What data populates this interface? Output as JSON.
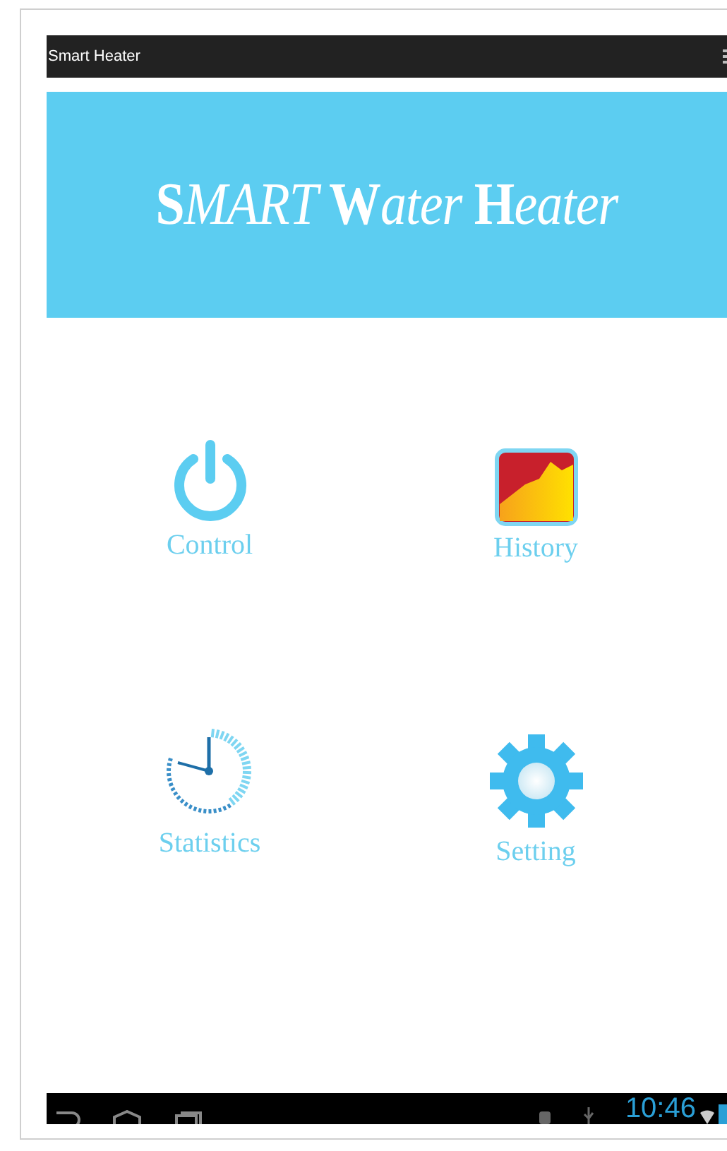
{
  "action_bar": {
    "title": "Smart Heater"
  },
  "banner": {
    "title": [
      {
        "text": "S",
        "bold": true
      },
      {
        "text": "MART ",
        "bold": false
      },
      {
        "text": "W",
        "bold": true
      },
      {
        "text": "ater ",
        "bold": false
      },
      {
        "text": "H",
        "bold": true
      },
      {
        "text": "eater",
        "bold": false
      }
    ]
  },
  "tiles": [
    {
      "kind": "power",
      "label": "Control"
    },
    {
      "kind": "chart",
      "label": "History"
    },
    {
      "kind": "clock",
      "label": "Statistics"
    },
    {
      "kind": "gear",
      "label": "Setting"
    }
  ],
  "nav_bar": {
    "time": "10:46"
  }
}
